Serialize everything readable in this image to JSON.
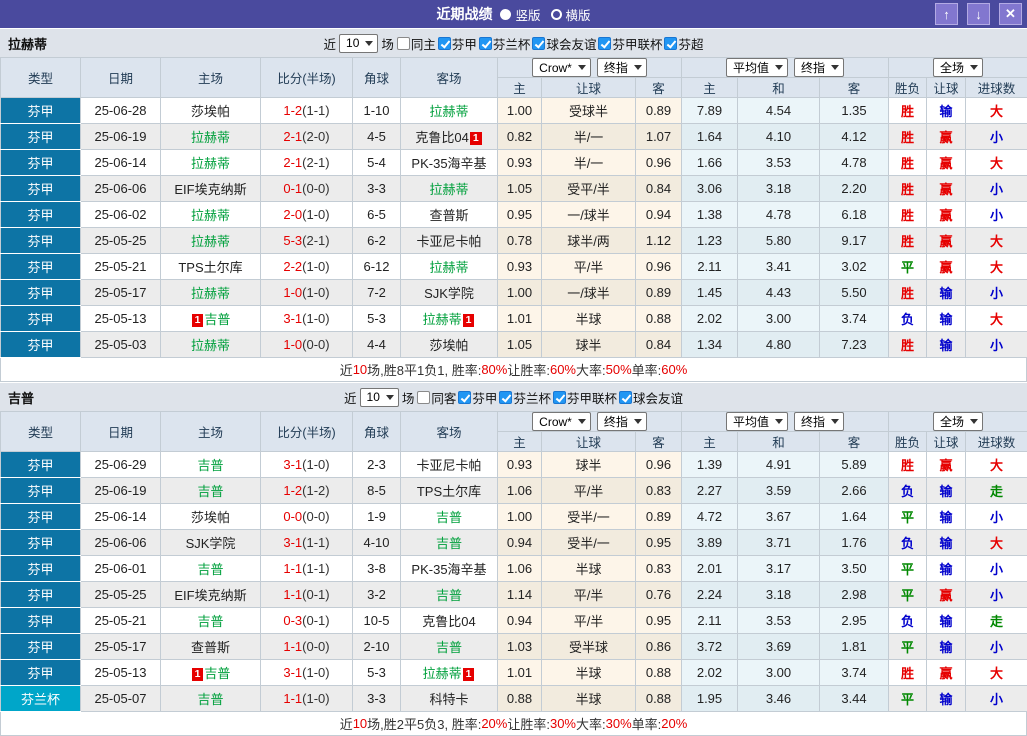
{
  "titlebar": {
    "title": "近期战绩",
    "up_icon": "↑",
    "down_icon": "↓",
    "close_icon": "✕",
    "radios": [
      {
        "label": "竖版",
        "selected": true
      },
      {
        "label": "横版",
        "selected": false
      }
    ]
  },
  "colors": {
    "titlebar_bg": "#4a4a9e",
    "league_cell": "#0d74a5",
    "cup_cell": "#00a6c9",
    "accent_red": "#e60000",
    "accent_blue": "#0000cc",
    "accent_green": "#008800",
    "team_green": "#00a03c"
  },
  "result_colors": {
    "胜": "#e60000",
    "赢": "#e60000",
    "大": "#e60000",
    "负": "#0000cc",
    "输": "#0000cc",
    "小": "#0000cc",
    "平": "#008800",
    "走": "#008800"
  },
  "badge_text": "1",
  "table_header": {
    "type": "类型",
    "date": "日期",
    "home": "主场",
    "score": "比分(半场)",
    "corner": "角球",
    "away": "客场",
    "asia_home": "主",
    "asia_line": "让球",
    "asia_away": "客",
    "eu_home": "主",
    "eu_draw": "和",
    "eu_away": "客",
    "wdl": "胜负",
    "handicap": "让球",
    "goals": "进球数"
  },
  "sections": [
    {
      "team": "拉赫蒂",
      "filter": {
        "near_label": "近",
        "count": "10",
        "games_label": "场",
        "checkboxes": [
          {
            "label": "同主",
            "checked": false
          },
          {
            "label": "芬甲",
            "checked": true
          },
          {
            "label": "芬兰杯",
            "checked": true
          },
          {
            "label": "球会友谊",
            "checked": true
          },
          {
            "label": "芬甲联杯",
            "checked": true
          },
          {
            "label": "芬超",
            "checked": true
          }
        ]
      },
      "controls": {
        "bookmaker": "Crow*",
        "final_left": "终指",
        "average": "平均值",
        "final_right": "终指",
        "scope": "全场"
      },
      "rows": [
        {
          "league": "芬甲",
          "date": "25-06-28",
          "home": {
            "name": "莎埃帕"
          },
          "ft": "1-2",
          "ht": "(1-1)",
          "corner": "1-10",
          "away": {
            "name": "拉赫蒂",
            "green": true
          },
          "asia": [
            "1.00",
            "受球半",
            "0.89"
          ],
          "avg": [
            "7.89",
            "4.54",
            "1.35"
          ],
          "res": [
            "胜",
            "输",
            "大"
          ]
        },
        {
          "league": "芬甲",
          "date": "25-06-19",
          "home": {
            "name": "拉赫蒂",
            "green": true
          },
          "ft": "2-1",
          "ht": "(2-0)",
          "corner": "4-5",
          "away": {
            "name": "克鲁比04",
            "badge": "1",
            "badge_pos": "after"
          },
          "asia": [
            "0.82",
            "半/一",
            "1.07"
          ],
          "avg": [
            "1.64",
            "4.10",
            "4.12"
          ],
          "res": [
            "胜",
            "赢",
            "小"
          ]
        },
        {
          "league": "芬甲",
          "date": "25-06-14",
          "home": {
            "name": "拉赫蒂",
            "green": true
          },
          "ft": "2-1",
          "ht": "(2-1)",
          "corner": "5-4",
          "away": {
            "name": "PK-35海辛基"
          },
          "asia": [
            "0.93",
            "半/一",
            "0.96"
          ],
          "avg": [
            "1.66",
            "3.53",
            "4.78"
          ],
          "res": [
            "胜",
            "赢",
            "大"
          ]
        },
        {
          "league": "芬甲",
          "date": "25-06-06",
          "home": {
            "name": "EIF埃克纳斯"
          },
          "ft": "0-1",
          "ht": "(0-0)",
          "corner": "3-3",
          "away": {
            "name": "拉赫蒂",
            "green": true
          },
          "asia": [
            "1.05",
            "受平/半",
            "0.84"
          ],
          "avg": [
            "3.06",
            "3.18",
            "2.20"
          ],
          "res": [
            "胜",
            "赢",
            "小"
          ]
        },
        {
          "league": "芬甲",
          "date": "25-06-02",
          "home": {
            "name": "拉赫蒂",
            "green": true
          },
          "ft": "2-0",
          "ht": "(1-0)",
          "corner": "6-5",
          "away": {
            "name": "查普斯"
          },
          "asia": [
            "0.95",
            "一/球半",
            "0.94"
          ],
          "avg": [
            "1.38",
            "4.78",
            "6.18"
          ],
          "res": [
            "胜",
            "赢",
            "小"
          ]
        },
        {
          "league": "芬甲",
          "date": "25-05-25",
          "home": {
            "name": "拉赫蒂",
            "green": true
          },
          "ft": "5-3",
          "ht": "(2-1)",
          "corner": "6-2",
          "away": {
            "name": "卡亚尼卡帕"
          },
          "asia": [
            "0.78",
            "球半/两",
            "1.12"
          ],
          "avg": [
            "1.23",
            "5.80",
            "9.17"
          ],
          "res": [
            "胜",
            "赢",
            "大"
          ]
        },
        {
          "league": "芬甲",
          "date": "25-05-21",
          "home": {
            "name": "TPS土尔库"
          },
          "ft": "2-2",
          "ht": "(1-0)",
          "corner": "6-12",
          "away": {
            "name": "拉赫蒂",
            "green": true
          },
          "asia": [
            "0.93",
            "平/半",
            "0.96"
          ],
          "avg": [
            "2.11",
            "3.41",
            "3.02"
          ],
          "res": [
            "平",
            "赢",
            "大"
          ]
        },
        {
          "league": "芬甲",
          "date": "25-05-17",
          "home": {
            "name": "拉赫蒂",
            "green": true
          },
          "ft": "1-0",
          "ht": "(1-0)",
          "corner": "7-2",
          "away": {
            "name": "SJK学院"
          },
          "asia": [
            "1.00",
            "一/球半",
            "0.89"
          ],
          "avg": [
            "1.45",
            "4.43",
            "5.50"
          ],
          "res": [
            "胜",
            "输",
            "小"
          ]
        },
        {
          "league": "芬甲",
          "date": "25-05-13",
          "home": {
            "name": "吉普",
            "green": true,
            "badge": "1",
            "badge_pos": "before"
          },
          "ft": "3-1",
          "ht": "(1-0)",
          "corner": "5-3",
          "away": {
            "name": "拉赫蒂",
            "green": true,
            "badge": "1",
            "badge_pos": "after"
          },
          "asia": [
            "1.01",
            "半球",
            "0.88"
          ],
          "avg": [
            "2.02",
            "3.00",
            "3.74"
          ],
          "res": [
            "负",
            "输",
            "大"
          ]
        },
        {
          "league": "芬甲",
          "date": "25-05-03",
          "home": {
            "name": "拉赫蒂",
            "green": true
          },
          "ft": "1-0",
          "ht": "(0-0)",
          "corner": "4-4",
          "away": {
            "name": "莎埃帕"
          },
          "asia": [
            "1.05",
            "球半",
            "0.84"
          ],
          "avg": [
            "1.34",
            "4.80",
            "7.23"
          ],
          "res": [
            "胜",
            "输",
            "小"
          ]
        }
      ],
      "summary": [
        {
          "t": "近"
        },
        {
          "t": "10",
          "r": true
        },
        {
          "t": "场,胜8平1负1, 胜率:"
        },
        {
          "t": "80%",
          "r": true
        },
        {
          "t": " 让胜率:"
        },
        {
          "t": "60%",
          "r": true
        },
        {
          "t": " 大率:"
        },
        {
          "t": "50%",
          "r": true
        },
        {
          "t": " 单率:"
        },
        {
          "t": "60%",
          "r": true
        }
      ]
    },
    {
      "team": "吉普",
      "filter": {
        "near_label": "近",
        "count": "10",
        "games_label": "场",
        "checkboxes": [
          {
            "label": "同客",
            "checked": false
          },
          {
            "label": "芬甲",
            "checked": true
          },
          {
            "label": "芬兰杯",
            "checked": true
          },
          {
            "label": "芬甲联杯",
            "checked": true
          },
          {
            "label": "球会友谊",
            "checked": true
          }
        ]
      },
      "controls": {
        "bookmaker": "Crow*",
        "final_left": "终指",
        "average": "平均值",
        "final_right": "终指",
        "scope": "全场"
      },
      "rows": [
        {
          "league": "芬甲",
          "date": "25-06-29",
          "home": {
            "name": "吉普",
            "green": true
          },
          "ft": "3-1",
          "ht": "(1-0)",
          "corner": "2-3",
          "away": {
            "name": "卡亚尼卡帕"
          },
          "asia": [
            "0.93",
            "球半",
            "0.96"
          ],
          "avg": [
            "1.39",
            "4.91",
            "5.89"
          ],
          "res": [
            "胜",
            "赢",
            "大"
          ]
        },
        {
          "league": "芬甲",
          "date": "25-06-19",
          "home": {
            "name": "吉普",
            "green": true
          },
          "ft": "1-2",
          "ht": "(1-2)",
          "corner": "8-5",
          "away": {
            "name": "TPS土尔库"
          },
          "asia": [
            "1.06",
            "平/半",
            "0.83"
          ],
          "avg": [
            "2.27",
            "3.59",
            "2.66"
          ],
          "res": [
            "负",
            "输",
            "走"
          ]
        },
        {
          "league": "芬甲",
          "date": "25-06-14",
          "home": {
            "name": "莎埃帕"
          },
          "ft": "0-0",
          "ht": "(0-0)",
          "corner": "1-9",
          "away": {
            "name": "吉普",
            "green": true
          },
          "asia": [
            "1.00",
            "受半/一",
            "0.89"
          ],
          "avg": [
            "4.72",
            "3.67",
            "1.64"
          ],
          "res": [
            "平",
            "输",
            "小"
          ]
        },
        {
          "league": "芬甲",
          "date": "25-06-06",
          "home": {
            "name": "SJK学院"
          },
          "ft": "3-1",
          "ht": "(1-1)",
          "corner": "4-10",
          "away": {
            "name": "吉普",
            "green": true
          },
          "asia": [
            "0.94",
            "受半/一",
            "0.95"
          ],
          "avg": [
            "3.89",
            "3.71",
            "1.76"
          ],
          "res": [
            "负",
            "输",
            "大"
          ]
        },
        {
          "league": "芬甲",
          "date": "25-06-01",
          "home": {
            "name": "吉普",
            "green": true
          },
          "ft": "1-1",
          "ht": "(1-1)",
          "corner": "3-8",
          "away": {
            "name": "PK-35海辛基"
          },
          "asia": [
            "1.06",
            "半球",
            "0.83"
          ],
          "avg": [
            "2.01",
            "3.17",
            "3.50"
          ],
          "res": [
            "平",
            "输",
            "小"
          ]
        },
        {
          "league": "芬甲",
          "date": "25-05-25",
          "home": {
            "name": "EIF埃克纳斯"
          },
          "ft": "1-1",
          "ht": "(0-1)",
          "corner": "3-2",
          "away": {
            "name": "吉普",
            "green": true
          },
          "asia": [
            "1.14",
            "平/半",
            "0.76"
          ],
          "avg": [
            "2.24",
            "3.18",
            "2.98"
          ],
          "res": [
            "平",
            "赢",
            "小"
          ]
        },
        {
          "league": "芬甲",
          "date": "25-05-21",
          "home": {
            "name": "吉普",
            "green": true
          },
          "ft": "0-3",
          "ht": "(0-1)",
          "corner": "10-5",
          "away": {
            "name": "克鲁比04"
          },
          "asia": [
            "0.94",
            "平/半",
            "0.95"
          ],
          "avg": [
            "2.11",
            "3.53",
            "2.95"
          ],
          "res": [
            "负",
            "输",
            "走"
          ]
        },
        {
          "league": "芬甲",
          "date": "25-05-17",
          "home": {
            "name": "查普斯"
          },
          "ft": "1-1",
          "ht": "(0-0)",
          "corner": "2-10",
          "away": {
            "name": "吉普",
            "green": true
          },
          "asia": [
            "1.03",
            "受半球",
            "0.86"
          ],
          "avg": [
            "3.72",
            "3.69",
            "1.81"
          ],
          "res": [
            "平",
            "输",
            "小"
          ]
        },
        {
          "league": "芬甲",
          "date": "25-05-13",
          "home": {
            "name": "吉普",
            "green": true,
            "badge": "1",
            "badge_pos": "before"
          },
          "ft": "3-1",
          "ht": "(1-0)",
          "corner": "5-3",
          "away": {
            "name": "拉赫蒂",
            "green": true,
            "badge": "1",
            "badge_pos": "after"
          },
          "asia": [
            "1.01",
            "半球",
            "0.88"
          ],
          "avg": [
            "2.02",
            "3.00",
            "3.74"
          ],
          "res": [
            "胜",
            "赢",
            "大"
          ]
        },
        {
          "league": "芬兰杯",
          "cup": true,
          "date": "25-05-07",
          "home": {
            "name": "吉普",
            "green": true
          },
          "ft": "1-1",
          "ht": "(1-0)",
          "corner": "3-3",
          "away": {
            "name": "科特卡"
          },
          "asia": [
            "0.88",
            "半球",
            "0.88"
          ],
          "avg": [
            "1.95",
            "3.46",
            "3.44"
          ],
          "res": [
            "平",
            "输",
            "小"
          ]
        }
      ],
      "summary": [
        {
          "t": "近"
        },
        {
          "t": "10",
          "r": true
        },
        {
          "t": "场,胜2平5负3, 胜率:"
        },
        {
          "t": "20%",
          "r": true
        },
        {
          "t": " 让胜率:"
        },
        {
          "t": "30%",
          "r": true
        },
        {
          "t": " 大率:"
        },
        {
          "t": "30%",
          "r": true
        },
        {
          "t": " 单率:"
        },
        {
          "t": "20%",
          "r": true
        }
      ]
    }
  ]
}
